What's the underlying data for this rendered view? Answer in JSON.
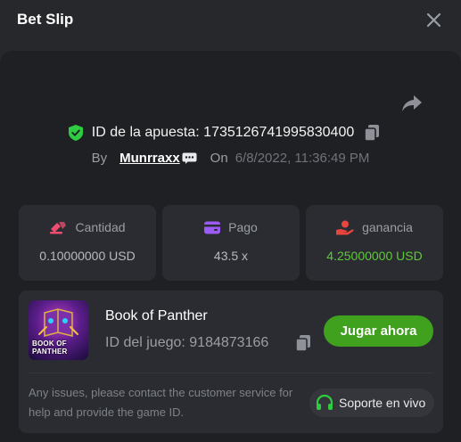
{
  "header": {
    "title": "Bet Slip"
  },
  "bet": {
    "id_label": "ID de la apuesta: 173512674199583040​0",
    "by_label": "By",
    "username": "Munrraxx",
    "on_label": "On",
    "date": "6/8/2022, 11:36:49 PM"
  },
  "stats": {
    "amount": {
      "label": "Cantidad",
      "value": "0.10000000 USD",
      "icon": "bet-amount-icon",
      "color": "#ee4d6f"
    },
    "payout": {
      "label": "Pago",
      "value": "43.5 x",
      "icon": "wallet-icon",
      "color": "#9b5cf5"
    },
    "profit": {
      "label": "ganancia",
      "value": "4.25000000 USD",
      "icon": "profit-hand-icon",
      "color": "#e8453c",
      "value_color": "#5ec938"
    }
  },
  "game": {
    "name": "Book of Panther",
    "id_label": "ID del juego: 9184873166",
    "thumb_text_line1": "BOOK OF",
    "thumb_text_line2": "PANTHER",
    "play_label": "Jugar ahora"
  },
  "support": {
    "text": "Any issues, please contact the customer service for help and provide the game ID.",
    "button_label": "Soporte en vivo"
  },
  "colors": {
    "accent_green": "#3fa11e",
    "shield_green": "#2ecc40"
  }
}
